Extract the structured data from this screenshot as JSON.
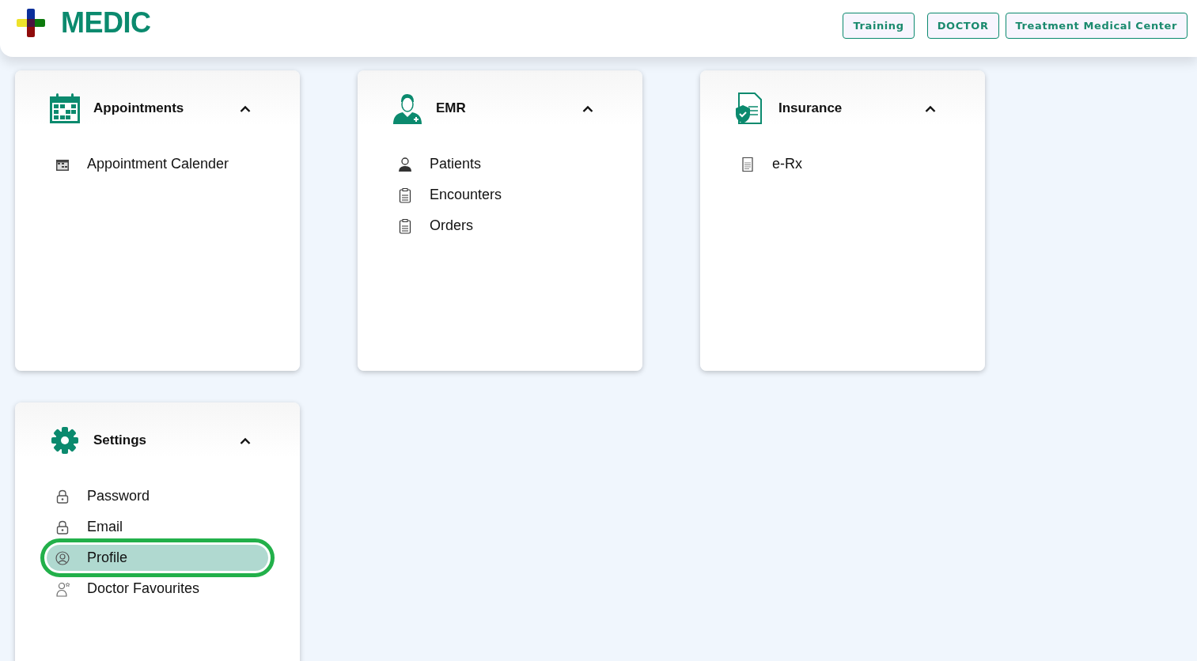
{
  "header": {
    "logo_text": "MEDIC",
    "buttons": [
      "Training",
      "DOCTOR",
      "Treatment Medical Center"
    ]
  },
  "cards": [
    {
      "title": "Appointments",
      "kind": "calendar",
      "expanded": true,
      "items": [
        {
          "label": "Appointment Calender",
          "kind": "calendar",
          "selected": false
        }
      ]
    },
    {
      "title": "EMR",
      "kind": "doctor",
      "expanded": true,
      "items": [
        {
          "label": "Patients",
          "kind": "patient",
          "selected": false
        },
        {
          "label": "Encounters",
          "kind": "clipboard",
          "selected": false
        },
        {
          "label": "Orders",
          "kind": "orders",
          "selected": false
        }
      ]
    },
    {
      "title": "Insurance",
      "kind": "insurance",
      "expanded": true,
      "items": [
        {
          "label": "e-Rx",
          "kind": "rx",
          "selected": false
        }
      ]
    },
    {
      "title": "Settings",
      "kind": "gear",
      "expanded": true,
      "items": [
        {
          "label": "Password",
          "kind": "lock",
          "selected": false
        },
        {
          "label": "Email",
          "kind": "lock",
          "selected": false
        },
        {
          "label": "Profile",
          "kind": "profile",
          "selected": true
        },
        {
          "label": "Doctor Favourites",
          "kind": "doctor-fav",
          "selected": false
        }
      ]
    }
  ]
}
